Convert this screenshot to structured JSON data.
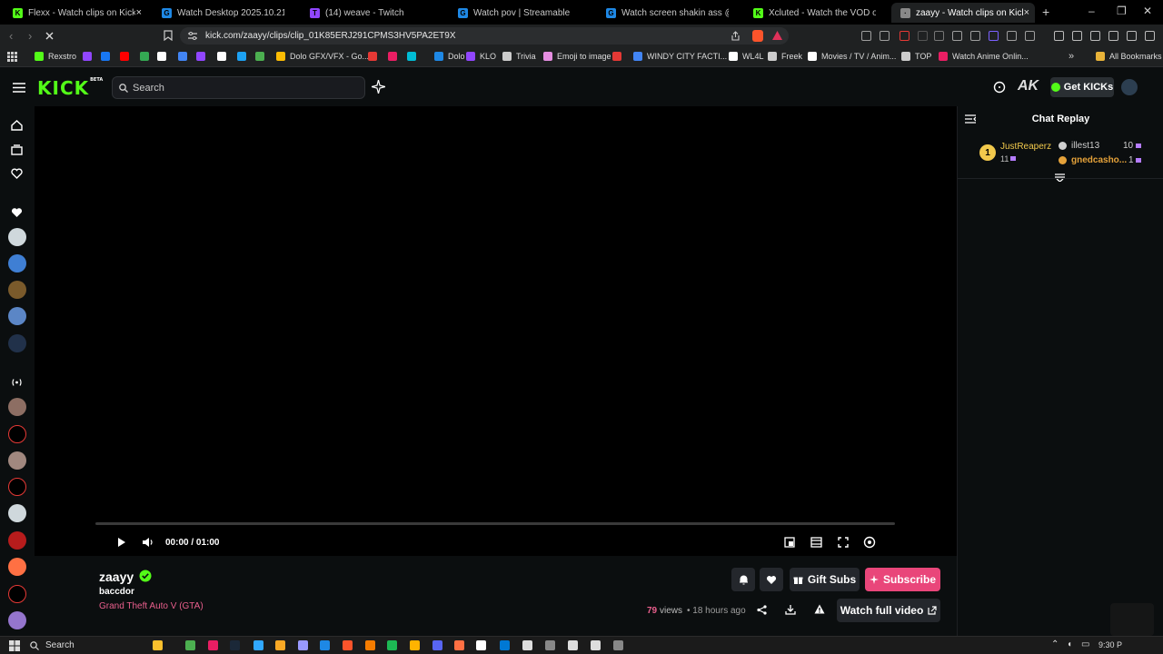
{
  "browser": {
    "tabs": [
      {
        "title": "Flexx - Watch clips on Kick",
        "favicon_color": "#53fc18",
        "favicon_glyph": "K",
        "active": false
      },
      {
        "title": "Watch Desktop 2025.10.21 - 05.01.5",
        "favicon_color": "#1e88e5",
        "favicon_glyph": "G",
        "active": false
      },
      {
        "title": "(14) weave - Twitch",
        "favicon_color": "#9146ff",
        "favicon_glyph": "T",
        "active": false
      },
      {
        "title": "Watch pov | Streamable",
        "favicon_color": "#1e88e5",
        "favicon_glyph": "G",
        "active": false
      },
      {
        "title": "Watch screen shakin ass @sark | Stre",
        "favicon_color": "#1e88e5",
        "favicon_glyph": "G",
        "active": false
      },
      {
        "title": "Xcluted - Watch the VOD on Kick",
        "favicon_color": "#53fc18",
        "favicon_glyph": "K",
        "active": false
      },
      {
        "title": "zaayy - Watch clips on Kick",
        "favicon_color": "#888888",
        "favicon_glyph": "·",
        "active": true
      }
    ],
    "new_tab_glyph": "+",
    "close_glyph": "×",
    "window_controls": [
      "–",
      "❐",
      "✕"
    ],
    "url": "kick.com/zaayy/clips/clip_01K85ERJ291CPMS3HV5PA2ET9X",
    "bookmarks": [
      {
        "label": "Rexstro",
        "color": "#53fc18"
      },
      {
        "label": "Dolo GFX/VFX - Go...",
        "color": "#fbbc04"
      },
      {
        "label": "Dolo",
        "color": "#1e88e5"
      },
      {
        "label": "KLO",
        "color": "#9146ff"
      },
      {
        "label": "Trivia",
        "color": "#cccccc"
      },
      {
        "label": "Emoji to image",
        "color": "#e58ee1"
      },
      {
        "label": "WINDY CITY FACTI...",
        "color": "#4285f4"
      },
      {
        "label": "WL4L",
        "color": "#ffffff"
      },
      {
        "label": "Freek",
        "color": "#cccccc"
      },
      {
        "label": "Movies / TV / Anim...",
        "color": "#ffffff"
      },
      {
        "label": "TOP",
        "color": "#cccccc"
      },
      {
        "label": "Watch Anime Onlin...",
        "color": "#e91e63"
      }
    ],
    "all_bookmarks": "All Bookmarks"
  },
  "kick": {
    "search_placeholder": "Search",
    "get_kicks": "Get KICKs",
    "colors": {
      "brand": "#53fc18",
      "subscribe": "#e9467a",
      "link": "#ea5f8d",
      "gold": "#f2c94c"
    }
  },
  "chat": {
    "title": "Chat Replay",
    "leaderboard": [
      {
        "rank": "1",
        "name": "JustReaperz",
        "count": "11",
        "color": "#f2c94c"
      },
      {
        "name": "illest13",
        "count": "10",
        "color": "#cfcfcf"
      },
      {
        "name": "gnedcasho...",
        "count": "1",
        "color": "#e5a23a"
      }
    ]
  },
  "player": {
    "time": "00:00 / 01:00",
    "progress_fraction": 0
  },
  "clip": {
    "channel": "zaayy",
    "clip_title": "baccdor",
    "category": "Grand Theft Auto V (GTA)",
    "views_count": "79",
    "views_label": "views",
    "age": "• 18 hours ago",
    "gift_subs": "Gift Subs",
    "subscribe": "Subscribe",
    "watch_full": "Watch full video"
  },
  "taskbar": {
    "search": "Search",
    "clock": "9:30 P"
  }
}
